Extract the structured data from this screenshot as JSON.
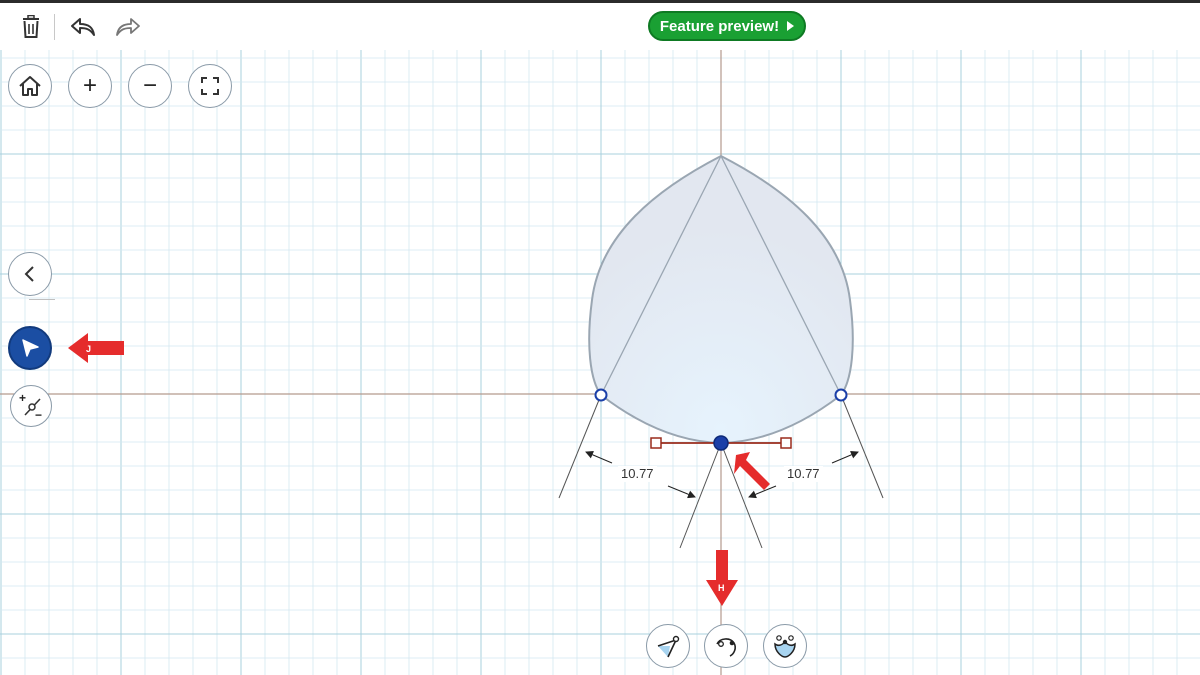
{
  "toolbar": {
    "delete_icon": "trash-icon",
    "undo_icon": "undo-icon",
    "redo_icon": "redo-icon",
    "feature_preview_label": "Feature preview!"
  },
  "view_controls": {
    "home_icon": "home-icon",
    "zoom_in_label": "+",
    "zoom_out_label": "−",
    "fit_icon": "fit-screen-icon"
  },
  "side_tools": {
    "collapse_icon": "chevron-left-icon",
    "select_icon": "select-pointer-icon",
    "point_tool_icon": "add-point-icon",
    "point_tool_plus": "+",
    "point_tool_minus": "−"
  },
  "annotations": {
    "left_measure": "10.77",
    "right_measure": "10.77",
    "select_arrow_letter": "J",
    "bottom_arrow_letter": "H"
  },
  "bottom_tools": {
    "tool1_icon": "compass-tool-icon",
    "tool2_icon": "arc-tool-icon",
    "tool3_icon": "shape-tool-icon"
  },
  "colors": {
    "grid_minor": "#d3e8f0",
    "grid_major": "#a9d0dd",
    "axis": "#b59a8e",
    "shape_fill": "#e4ebf3",
    "shape_stroke": "#9aa6b2",
    "control_point": "#1b3fa8",
    "handle": "#9a2b1c",
    "annotation_red": "#e52c2c",
    "feature_green": "#1aa033",
    "active_tool": "#1b4ea3"
  }
}
